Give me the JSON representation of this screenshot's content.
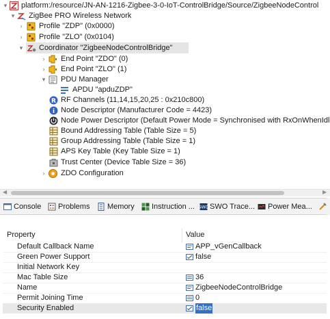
{
  "tree": {
    "root": "platform:/resource/JN-AN-1216-Zigbee-3-0-IoT-ControlBridge/Source/ZigbeeNodeControl",
    "network": "ZigBee PRO Wireless Network",
    "profile_zdp": "Profile \"ZDP\" (0x0000)",
    "profile_zlo": "Profile \"ZLO\" (0x0104)",
    "coordinator": "Coordinator \"ZigbeeNodeControlBridge\"",
    "endpoint_zdo": "End Point \"ZDO\" (0)",
    "endpoint_zlo": "End Point \"ZLO\" (1)",
    "pdu_manager": "PDU Manager",
    "apdu": "APDU \"apduZDP\"",
    "rf_channels": "RF Channels (11,14,15,20,25 : 0x210c800)",
    "node_descriptor": "Node Descriptor (Manufacturer Code = 4423)",
    "node_power_descriptor": "Node Power Descriptor (Default Power Mode = Synchronised with RxOnWhenIdle,",
    "bound_table": "Bound Addressing Table (Table Size = 5)",
    "group_table": "Group Addressing Table (Table Size = 1)",
    "aps_key_table": "APS Key Table (Key Table Size = 1)",
    "trust_center": "Trust Center (Device Table Size = 36)",
    "zdo_configuration": "ZDO Configuration"
  },
  "tabs": {
    "console": "Console",
    "problems": "Problems",
    "memory": "Memory",
    "instruction": "Instruction ...",
    "swo_trace": "SWO Trace...",
    "power_meas": "Power Mea..."
  },
  "properties": {
    "header_property": "Property",
    "header_value": "Value",
    "rows": [
      {
        "name": "Default Callback Name",
        "value": "APP_vGenCallback"
      },
      {
        "name": "Green Power Support",
        "value": "false"
      },
      {
        "name": "Initial Network Key",
        "value": ""
      },
      {
        "name": "Mac Table Size",
        "value": "36"
      },
      {
        "name": "Name",
        "value": "ZigbeeNodeControlBridge"
      },
      {
        "name": "Permit Joining Time",
        "value": "0"
      },
      {
        "name": "Security Enabled",
        "value": "false"
      }
    ]
  },
  "colors": {
    "selection_highlight": "#3470c8",
    "selected_row": "#e5e5e5",
    "tab_bar": "#f2f2f2"
  }
}
